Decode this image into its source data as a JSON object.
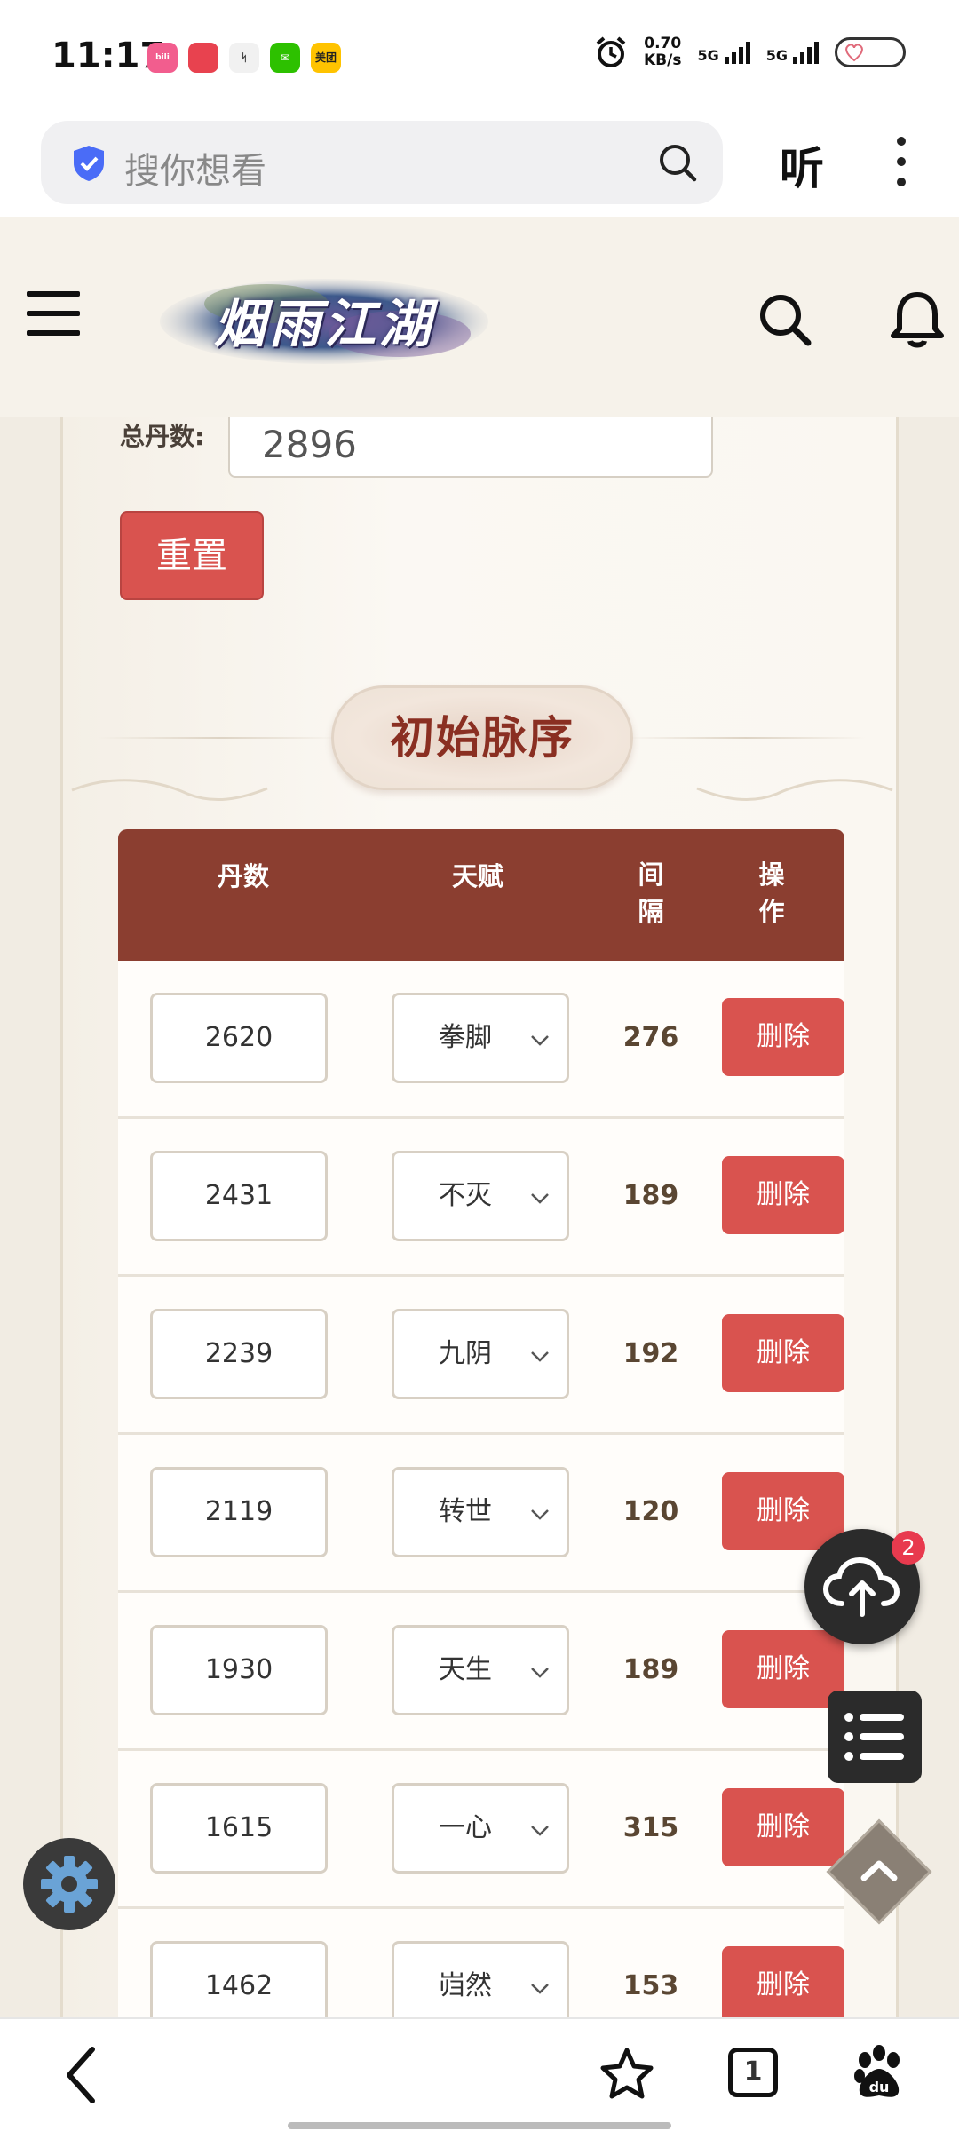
{
  "status_bar": {
    "time": "11:17",
    "app_icons": [
      {
        "name": "bilibili",
        "label": "bilibili",
        "color": "#f25d8e"
      },
      {
        "name": "app-red",
        "label": "",
        "color": "#e8424f"
      },
      {
        "name": "app-mono",
        "label": "",
        "color": "#f1f1f1"
      },
      {
        "name": "wechat",
        "label": "",
        "color": "#2dc100"
      },
      {
        "name": "meituan",
        "label": "美团",
        "color": "#ffc300"
      }
    ],
    "speed_value": "0.70",
    "speed_unit": "KB/s",
    "sim1": "5G",
    "sim2": "5G"
  },
  "browser": {
    "search_placeholder": "搜你想看",
    "listen_label": "听"
  },
  "site": {
    "logo_text": "烟雨江湖"
  },
  "form": {
    "total_label": "总丹数:",
    "total_value": "2896",
    "reset_label": "重置"
  },
  "section": {
    "title": "初始脉序"
  },
  "table": {
    "headers": {
      "dan": "丹数",
      "talent": "天赋",
      "gap_line1": "间",
      "gap_line2": "隔",
      "op_line1": "操",
      "op_line2": "作"
    },
    "delete_label": "删除",
    "rows": [
      {
        "dan": "2620",
        "talent": "拳脚",
        "gap": "276"
      },
      {
        "dan": "2431",
        "talent": "不灭",
        "gap": "189"
      },
      {
        "dan": "2239",
        "talent": "九阴",
        "gap": "192"
      },
      {
        "dan": "2119",
        "talent": "转世",
        "gap": "120"
      },
      {
        "dan": "1930",
        "talent": "天生",
        "gap": "189"
      },
      {
        "dan": "1615",
        "talent": "一心",
        "gap": "315"
      },
      {
        "dan": "1462",
        "talent": "岿然",
        "gap": "153"
      }
    ]
  },
  "floating": {
    "upload_badge": "2"
  },
  "bottom_bar": {
    "tab_count": "1"
  },
  "colors": {
    "accent_red": "#d9534f",
    "table_header": "#8b3e30",
    "section_title": "#8a2f22"
  }
}
